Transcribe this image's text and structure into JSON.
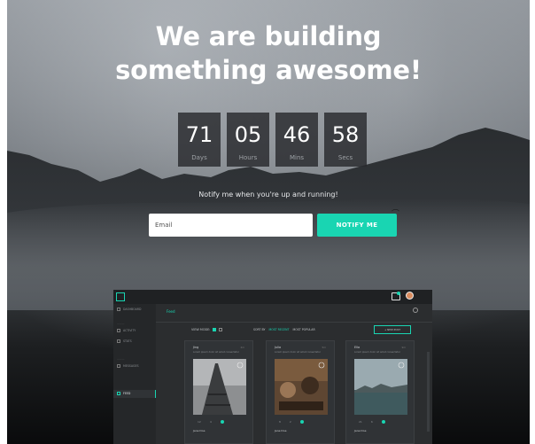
{
  "hero": {
    "headline_line1": "We are building",
    "headline_line2": "something awesome!"
  },
  "countdown": [
    {
      "value": "71",
      "label": "Days"
    },
    {
      "value": "05",
      "label": "Hours"
    },
    {
      "value": "46",
      "label": "Mins"
    },
    {
      "value": "58",
      "label": "Secs"
    }
  ],
  "notify": {
    "text": "Notify me when you're up and running!",
    "email_placeholder": "Email",
    "button_label": "NOTIFY ME"
  },
  "preview": {
    "title": "Feed",
    "view_mode_label": "VIEW MODE:",
    "sort_by_label": "SORT BY",
    "sort_recent": "MOST RECENT",
    "sort_popular": "MOST POPULAR",
    "new_post_label": "+ NEW POST",
    "sidebar": {
      "item1": "DASHBOARD",
      "item2": "ACTIVITY",
      "item3": "STATS",
      "item4": "MESSAGES",
      "item5": "FEED"
    },
    "cards": [
      {
        "user": "Jing",
        "time": "2m",
        "desc": "Lorem ipsum dolor sit amet consectetur",
        "foot": "Jane Doe",
        "likes": "12",
        "comments": "4"
      },
      {
        "user": "Julia",
        "time": "5m",
        "desc": "Lorem ipsum dolor sit amet consectetur",
        "foot": "Jane Doe",
        "likes": "8",
        "comments": "2"
      },
      {
        "user": "Ella",
        "time": "9m",
        "desc": "Lorem ipsum dolor sit amet consectetur",
        "foot": "Jane Doe",
        "likes": "21",
        "comments": "6"
      }
    ]
  },
  "colors": {
    "accent": "#19d5b2"
  }
}
